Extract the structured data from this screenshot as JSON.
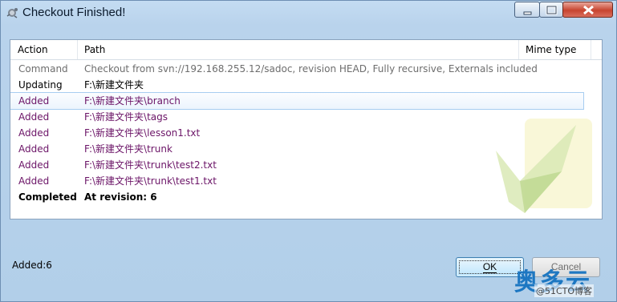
{
  "window": {
    "title": "Checkout Finished!"
  },
  "table": {
    "columns": [
      "Action",
      "Path",
      "Mime type"
    ],
    "rows": [
      {
        "action": "Command",
        "path": "Checkout from svn://192.168.255.12/sadoc, revision HEAD, Fully recursive, Externals included"
      },
      {
        "action": "Updating",
        "path": "F:\\新建文件夹"
      },
      {
        "action": "Added",
        "path": "F:\\新建文件夹\\branch"
      },
      {
        "action": "Added",
        "path": "F:\\新建文件夹\\tags"
      },
      {
        "action": "Added",
        "path": "F:\\新建文件夹\\lesson1.txt"
      },
      {
        "action": "Added",
        "path": "F:\\新建文件夹\\trunk"
      },
      {
        "action": "Added",
        "path": "F:\\新建文件夹\\trunk\\test2.txt"
      },
      {
        "action": "Added",
        "path": "F:\\新建文件夹\\trunk\\test1.txt"
      },
      {
        "action": "Completed",
        "path": "At revision: 6"
      }
    ]
  },
  "status": {
    "summary": "Added:6"
  },
  "buttons": {
    "ok": "OK",
    "cancel": "Cancel"
  },
  "watermark": {
    "logo": "奥多云",
    "credit": "@51CTO博客"
  },
  "colors": {
    "added": "#6b1467",
    "command": "#6d6d6d"
  }
}
